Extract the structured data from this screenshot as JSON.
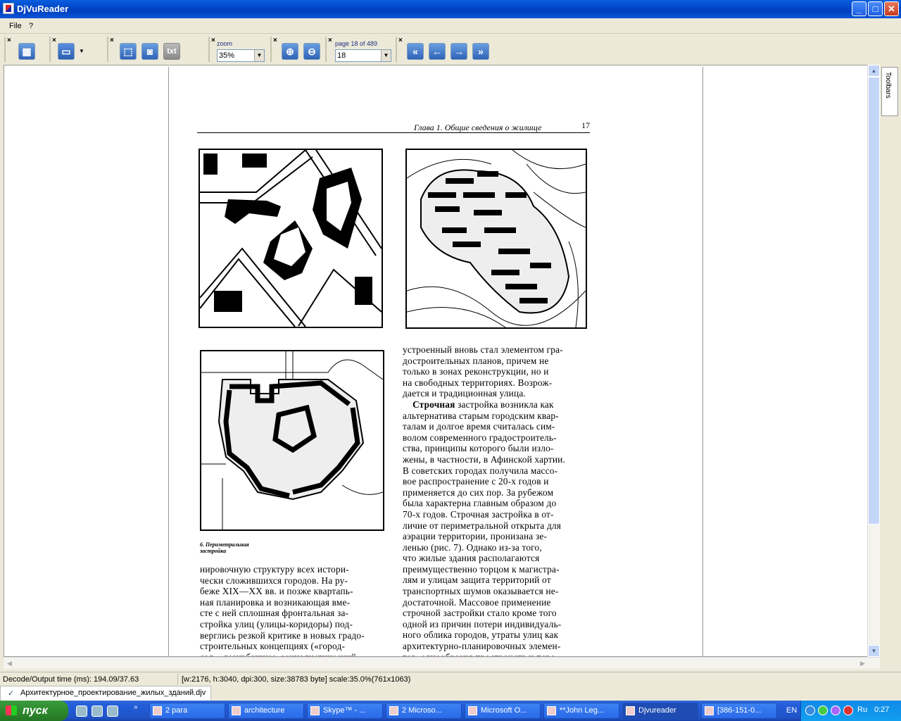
{
  "window": {
    "title": "DjVuReader",
    "minimize": "_",
    "maximize": "□",
    "close": "✕"
  },
  "menu": {
    "file": "File",
    "help": "?"
  },
  "toolbar": {
    "zoom_label": "zoom",
    "zoom_value": "35%",
    "page_label": "page 18 of 489",
    "page_value": "18",
    "txt_label": "txt",
    "close_mark": "×",
    "icons": [
      "layout-icon",
      "page-icon",
      "select-icon",
      "zoom-area-icon",
      "txt-icon",
      "zoom-in-icon",
      "zoom-out-icon",
      "first-page-icon",
      "prev-page-icon",
      "next-page-icon",
      "last-page-icon"
    ]
  },
  "side_tab": {
    "label": "Toolbars"
  },
  "document": {
    "header_title": "Глава 1. Общие сведения о жилище",
    "page_number": "17",
    "caption_line1": "6. Периметральная",
    "caption_line2": "застройка",
    "right_col": [
      "устроенный вновь стал элементом гра-",
      "достроительных планов, причем не",
      "только в зонах реконструкции, но и",
      "на свободных территориях. Возрож-",
      "дается и традиционная улица."
    ],
    "right_col_bold": "Строчная",
    "right_col2_first": " застройка возникла как",
    "right_col2": [
      "альтернатива старым городским квар-",
      "талам и долгое время считалась сим-",
      "волом современного градостроитель-",
      "ства, принципы которого были изло-",
      "жены, в частности, в Афинской хартии.",
      "В советских городах получила массо-",
      "вое распространение с 20-х годов и",
      "применяется до сих пор. За рубежом",
      "была характерна главным образом до",
      "70-х годов. Строчная застройка в от-",
      "личие от периметральной открыта для",
      "аэрации территории, пронизана зе-",
      "ленью (рис. 7). Однако из-за того,",
      "что жилые здания располагаются",
      "преимущественно торцом к магистра-",
      "лям и улицам защита территорий от",
      "транспортных шумов оказывается не-",
      "достаточной. Массовое применение",
      "строчной застройки стало кроме того",
      "одной из причин потери индивидуаль-",
      "ного облика городов, утраты улиц как",
      "архитектурно-планировочных элемен-",
      "тов, однообразия пространств и пере-"
    ],
    "left_col": [
      "нировочную структуру всех истори-",
      "чески сложившихся городов. На ру-",
      "беже XIX—XX вв. и позже квартапь-",
      "ная планировка и возникающая вме-",
      "сте с ней сплошная фронтальная за-",
      "стройка улиц (улицы-коридоры) под-",
      "верглись резкой критике в новых градо-",
      "строительных концепциях («город-",
      "сад», дезурбанизм, социалистический"
    ]
  },
  "status": {
    "decode": "Decode/Output time (ms): 194.09/37.63",
    "info": "[w:2176, h:3040, dpi:300, size:38783 byte] scale:35.0%(761x1063)",
    "file_tab": "Архитектурное_проектирование_жилых_зданий.djv"
  },
  "taskbar": {
    "start": "пуск",
    "tasks": [
      "2 para",
      "architecture",
      "Skype™ - ...",
      "2 Microso...",
      "Microsoft O...",
      "**John Leg...",
      "Djvureader",
      "[386-151-0..."
    ],
    "lang": "EN",
    "tray_lang": "Ru",
    "clock": "0:27"
  }
}
